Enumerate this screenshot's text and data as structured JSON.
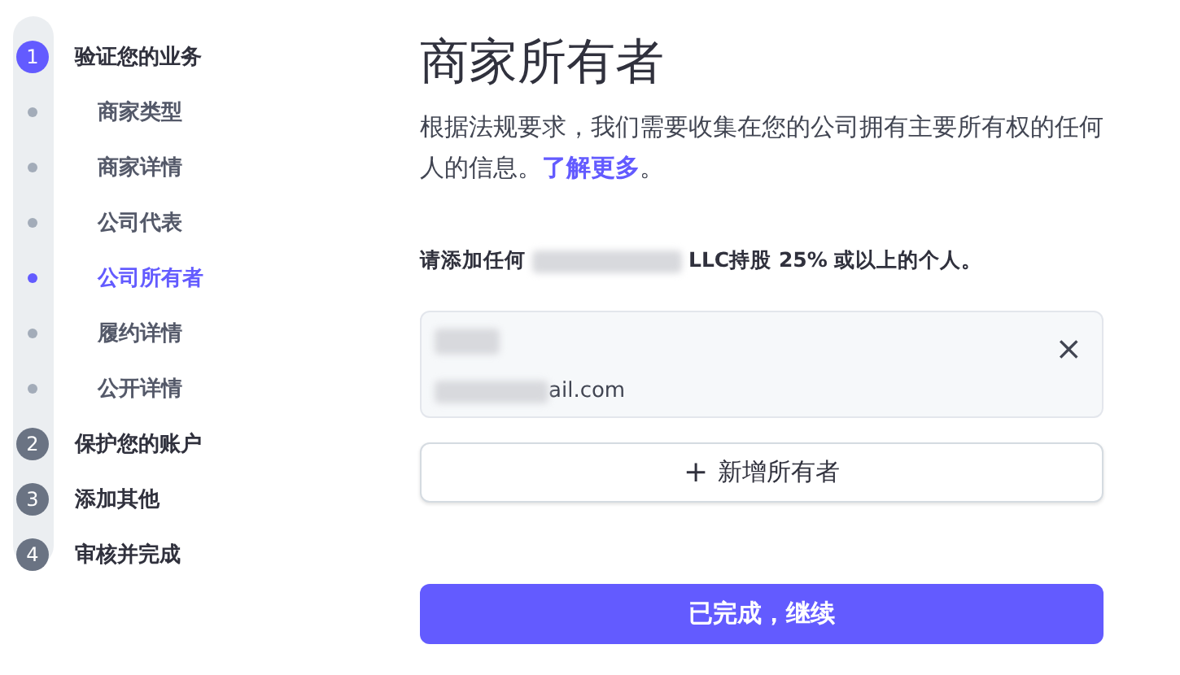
{
  "steps": [
    {
      "number": "1",
      "label": "验证您的业务",
      "active": true,
      "children": [
        {
          "label": "商家类型",
          "selected": false
        },
        {
          "label": "商家详情",
          "selected": false
        },
        {
          "label": "公司代表",
          "selected": false
        },
        {
          "label": "公司所有者",
          "selected": true
        },
        {
          "label": "履约详情",
          "selected": false
        },
        {
          "label": "公开详情",
          "selected": false
        }
      ]
    },
    {
      "number": "2",
      "label": "保护您的账户",
      "active": false
    },
    {
      "number": "3",
      "label": "添加其他",
      "active": false
    },
    {
      "number": "4",
      "label": "审核并完成",
      "active": false
    }
  ],
  "page": {
    "title": "商家所有者",
    "description": "根据法规要求，我们需要收集在您的公司拥有主要所有权的任何人的信息。",
    "link": "了解更多",
    "description_end": "。",
    "instruction_start": "请添加任何",
    "instruction_end": "LLC持股 25% 或以上的个人。",
    "owner": {
      "email_visible": "ail.com",
      "remove_icon": "×"
    },
    "add_button": {
      "icon": "+",
      "label": "新增所有者"
    },
    "continue_button": "已完成，继续"
  }
}
